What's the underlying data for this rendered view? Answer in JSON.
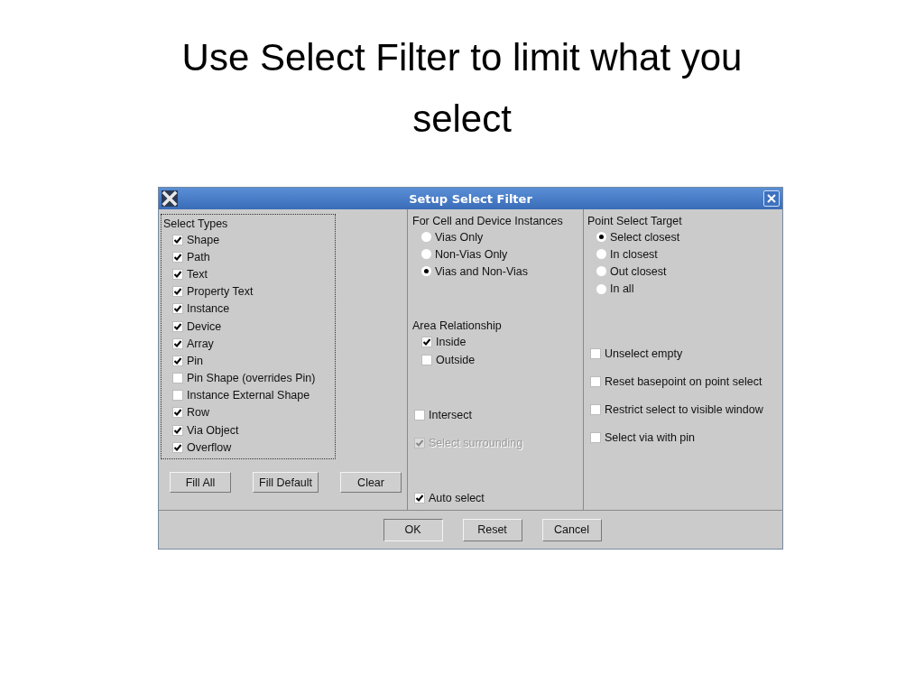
{
  "slide": {
    "title": "Use Select Filter to limit what you select"
  },
  "dialog": {
    "title": "Setup Select Filter",
    "select_types": {
      "label": "Select Types",
      "items": [
        {
          "label": "Shape",
          "checked": true
        },
        {
          "label": "Path",
          "checked": true
        },
        {
          "label": "Text",
          "checked": true
        },
        {
          "label": "Property Text",
          "checked": true
        },
        {
          "label": "Instance",
          "checked": true
        },
        {
          "label": "Device",
          "checked": true
        },
        {
          "label": "Array",
          "checked": true
        },
        {
          "label": "Pin",
          "checked": true
        },
        {
          "label": "Pin Shape (overrides Pin)",
          "checked": false
        },
        {
          "label": "Instance External Shape",
          "checked": false
        },
        {
          "label": "Row",
          "checked": true
        },
        {
          "label": "Via Object",
          "checked": true
        },
        {
          "label": "Overflow",
          "checked": true
        }
      ]
    },
    "type_buttons": [
      "Fill All",
      "Fill Default",
      "Clear"
    ],
    "instances": {
      "label": "For Cell and Device Instances",
      "options": [
        {
          "label": "Vias Only",
          "selected": false
        },
        {
          "label": "Non-Vias Only",
          "selected": false
        },
        {
          "label": "Vias and Non-Vias",
          "selected": true
        }
      ]
    },
    "area": {
      "label": "Area Relationship",
      "options": [
        {
          "label": "Inside",
          "checked": true
        },
        {
          "label": "Outside",
          "checked": false
        }
      ]
    },
    "extra_options": [
      {
        "label": "Intersect",
        "checked": false,
        "disabled": false
      },
      {
        "label": "Select surrounding",
        "checked": true,
        "disabled": true
      },
      {
        "label": "Auto select",
        "checked": true,
        "disabled": false
      }
    ],
    "point_target": {
      "label": "Point Select Target",
      "options": [
        {
          "label": "Select closest",
          "selected": true
        },
        {
          "label": "In closest",
          "selected": false
        },
        {
          "label": "Out closest",
          "selected": false
        },
        {
          "label": "In all",
          "selected": false
        }
      ]
    },
    "point_options": [
      {
        "label": "Unselect empty",
        "checked": false
      },
      {
        "label": "Reset basepoint on point select",
        "checked": false
      },
      {
        "label": "Restrict select to visible window",
        "checked": false
      },
      {
        "label": "Select via with pin",
        "checked": false
      }
    ],
    "buttons": [
      "OK",
      "Reset",
      "Cancel"
    ]
  }
}
